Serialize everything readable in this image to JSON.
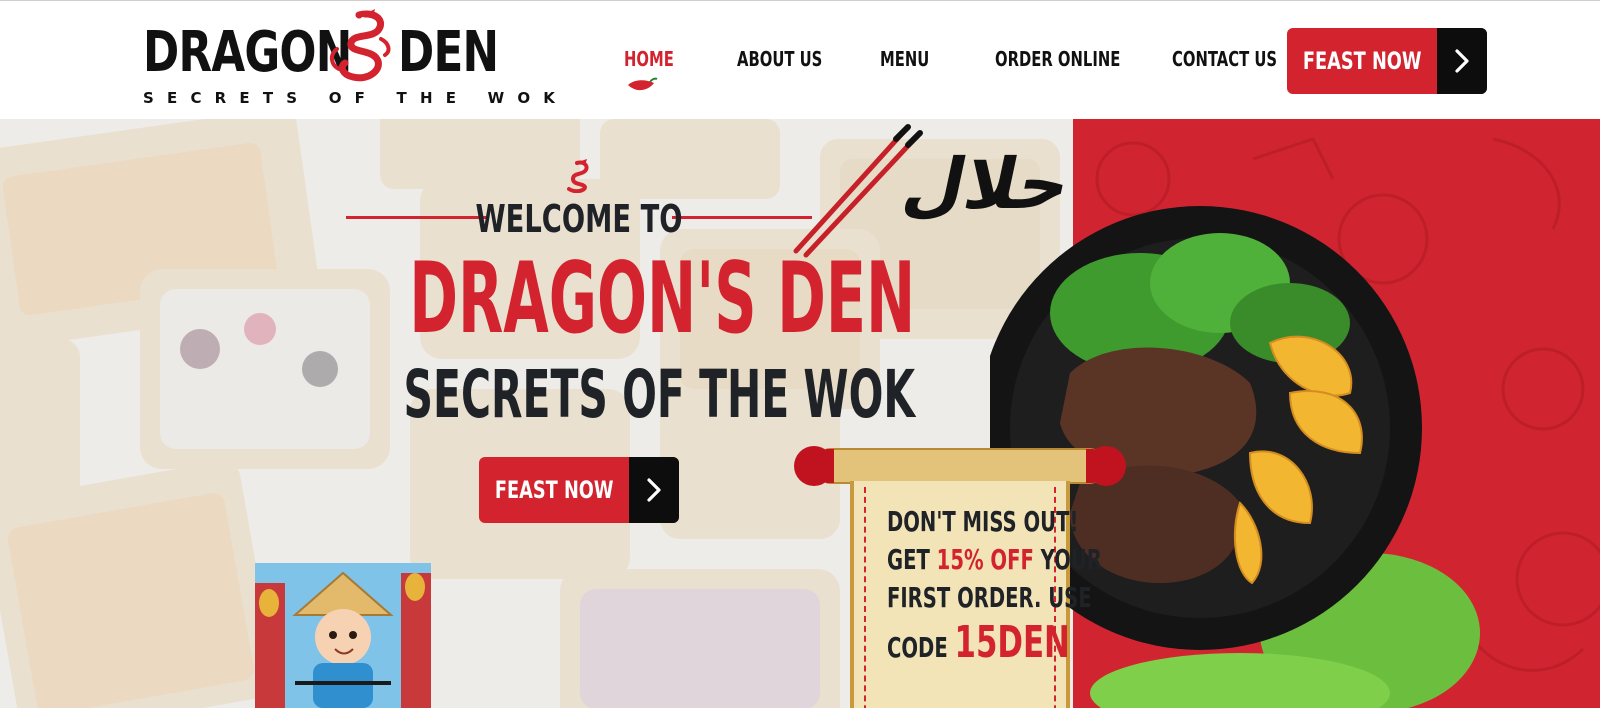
{
  "brand": {
    "name_part1": "DRAGON",
    "name_part2": "DEN",
    "tagline": "SECRETS OF THE WOK",
    "dragon_icon": "dragon-icon"
  },
  "nav": {
    "items": [
      {
        "label": "HOME",
        "active": true
      },
      {
        "label": "ABOUT US",
        "active": false
      },
      {
        "label": "MENU",
        "active": false
      },
      {
        "label": "ORDER ONLINE",
        "active": false
      },
      {
        "label": "CONTACT US",
        "active": false
      }
    ],
    "active_indicator_icon": "chili-icon",
    "cta_label": "FEAST NOW",
    "cta_icon": "chevron-right-icon"
  },
  "hero": {
    "welcome": "WELCOME TO",
    "title": "DRAGON'S DEN",
    "subtitle": "SECRETS OF THE WOK",
    "cta_label": "FEAST NOW",
    "cta_icon": "chevron-right-icon",
    "halal_text": "حلال",
    "promo": {
      "line1": "DON'T MISS OUT!",
      "line2_prefix": "GET ",
      "line2_highlight": "15% OFF",
      "line2_suffix": " YOUR",
      "line3": "FIRST ORDER. USE",
      "line4_prefix": "CODE ",
      "code": "15DEN"
    }
  },
  "colors": {
    "brand_red": "#d3232f",
    "panel_red": "#d02530",
    "dark": "#111111",
    "scroll_paper": "#f3e4b8"
  }
}
